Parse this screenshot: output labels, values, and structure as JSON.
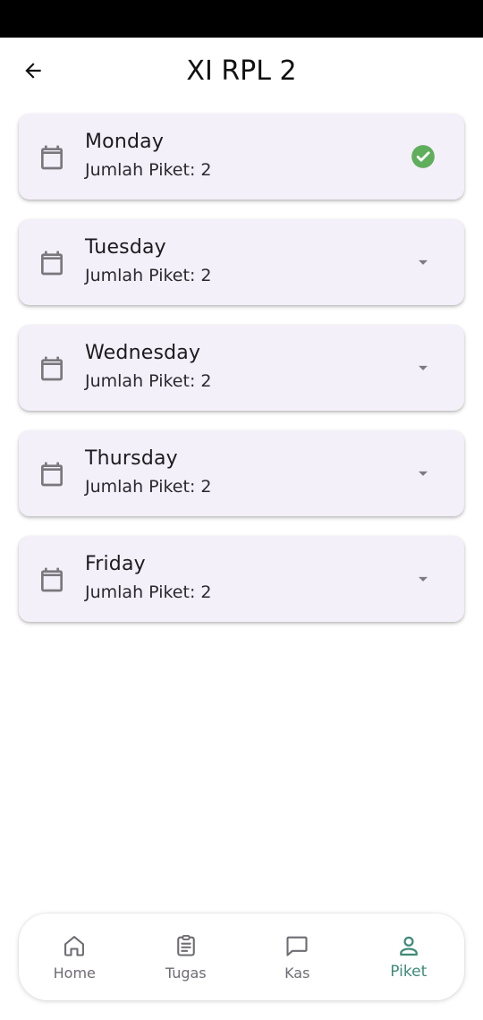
{
  "header": {
    "title": "XI RPL 2",
    "back_icon": "arrow-left-icon"
  },
  "days": [
    {
      "name": "Monday",
      "subtitle": "Jumlah Piket: 2",
      "status": "completed",
      "status_icon": "check-circle-icon"
    },
    {
      "name": "Tuesday",
      "subtitle": "Jumlah Piket: 2",
      "status": "collapsed",
      "status_icon": "dropdown-arrow-icon"
    },
    {
      "name": "Wednesday",
      "subtitle": "Jumlah Piket: 2",
      "status": "collapsed",
      "status_icon": "dropdown-arrow-icon"
    },
    {
      "name": "Thursday",
      "subtitle": "Jumlah Piket: 2",
      "status": "collapsed",
      "status_icon": "dropdown-arrow-icon"
    },
    {
      "name": "Friday",
      "subtitle": "Jumlah Piket: 2",
      "status": "collapsed",
      "status_icon": "dropdown-arrow-icon"
    }
  ],
  "bottom_nav": {
    "active": "Piket",
    "items": [
      {
        "label": "Home",
        "icon": "home-icon"
      },
      {
        "label": "Tugas",
        "icon": "clipboard-icon"
      },
      {
        "label": "Kas",
        "icon": "chat-icon"
      },
      {
        "label": "Piket",
        "icon": "person-icon"
      }
    ]
  },
  "colors": {
    "card_background": "#f4f0f9",
    "check_green": "#5fae5c",
    "active_nav": "#3e8a78",
    "inactive_nav": "#6f6b73",
    "icon_grey": "#7a777d"
  }
}
